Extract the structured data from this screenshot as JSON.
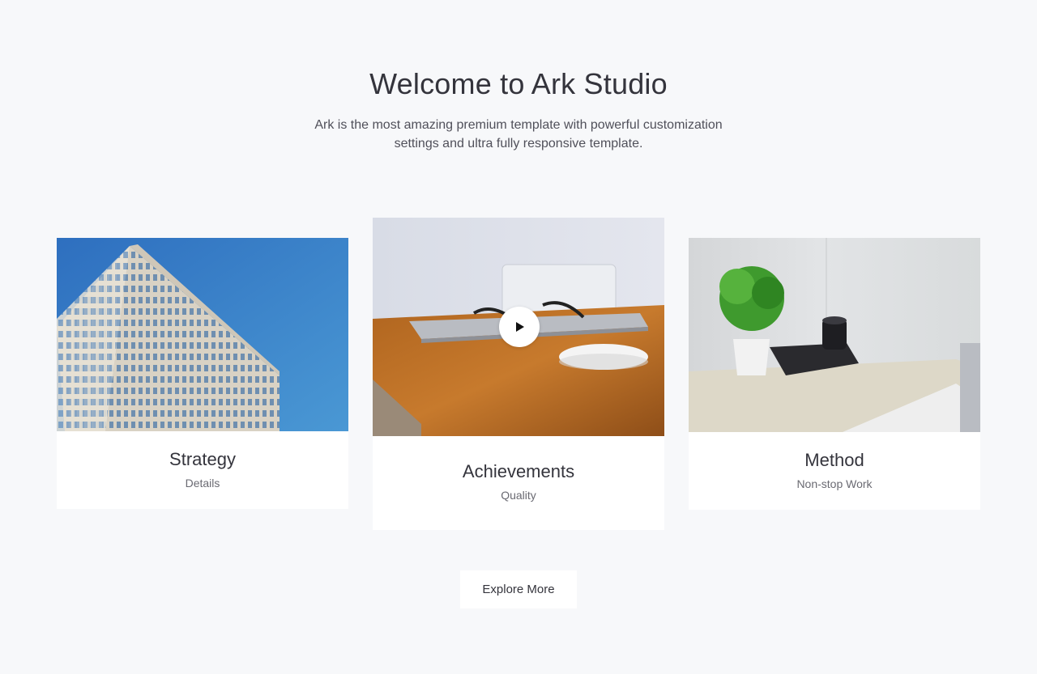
{
  "section": {
    "title": "Welcome to Ark Studio",
    "subtitle_line1": "Ark is the most amazing premium template with powerful customization",
    "subtitle_line2": "settings and ultra fully responsive template."
  },
  "cards": [
    {
      "title": "Strategy",
      "subtitle": "Details",
      "image": "office-building-photo"
    },
    {
      "title": "Achievements",
      "subtitle": "Quality",
      "image": "desk-laptop-glasses-photo",
      "icon": "play-icon"
    },
    {
      "title": "Method",
      "subtitle": "Non-stop Work",
      "image": "desk-plant-camera-photo"
    }
  ],
  "explore_button": {
    "label": "Explore More"
  },
  "colors": {
    "background": "#f7f8fa",
    "card": "#ffffff",
    "text": "#34343c",
    "muted": "#6a6a72"
  }
}
